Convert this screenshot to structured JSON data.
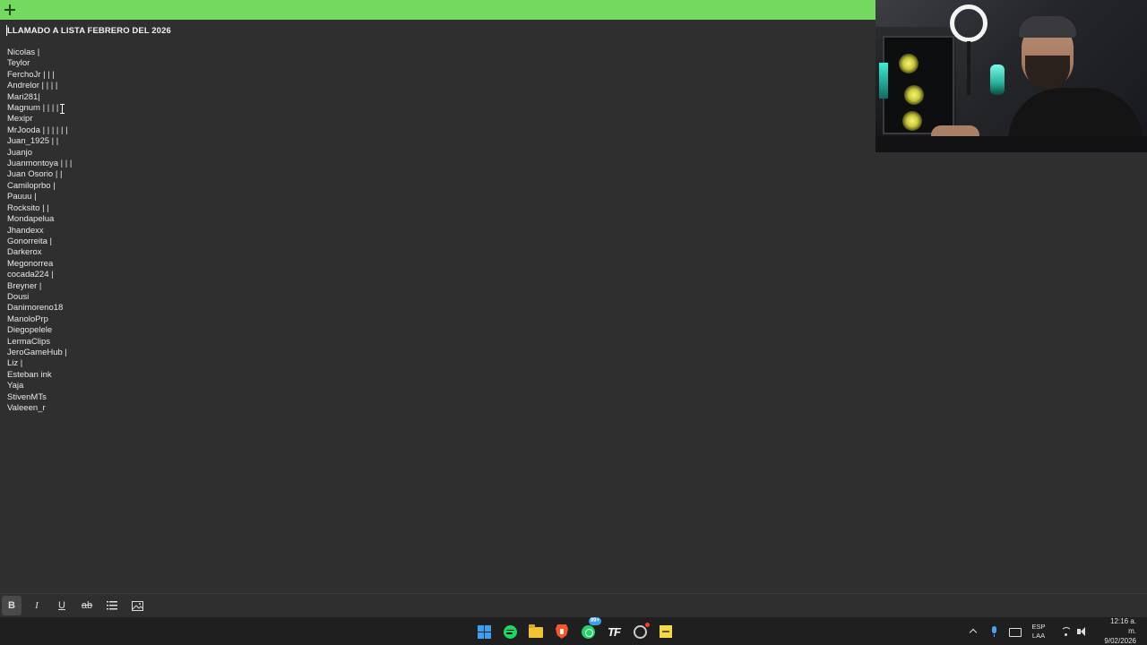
{
  "note": {
    "header_color": "#74d95f",
    "title": "LLAMADO A LISTA FEBRERO DEL 2026",
    "names": [
      "Nicolas |",
      "Teylor",
      "FerchoJr | | |",
      "Andrelor | | | |",
      "Mari281|",
      "Magnum | | | |",
      "Mexipr",
      "MrJooda | | | | | |",
      "Juan_1925 | |",
      "Juanjo",
      "Juanmontoya | | |",
      "Juan Osorio | |",
      "Camiloprbo |",
      "Pauuu |",
      "Rocksito | |",
      "Mondapelua",
      "Jhandexx",
      "Gonorreita |",
      "Darkerox",
      "Megonorrea",
      "cocada224 |",
      "Breyner |",
      "Dousi",
      "Danimoreno18",
      "ManoloPrp",
      "Diegopelele",
      "LermaClips",
      "JeroGameHub |",
      "Liz |",
      "Esteban ink",
      "Yaja",
      "StivenMTs",
      "Valeeen_r"
    ]
  },
  "format_toolbar": {
    "bold": "B",
    "italic": "I",
    "underline": "U",
    "strikethrough": "ab"
  },
  "taskbar": {
    "apps": [
      "windows-start-icon",
      "spotify-icon",
      "file-explorer-icon",
      "brave-icon",
      "whatsapp-icon",
      "tf-icon",
      "chrome-icon",
      "sticky-notes-icon"
    ],
    "whatsapp_badge": "99+",
    "tf_label": "TF",
    "lang_line1": "ESP",
    "lang_line2": "LAA",
    "time": "12:16 a. m.",
    "date": "9/02/2026"
  }
}
